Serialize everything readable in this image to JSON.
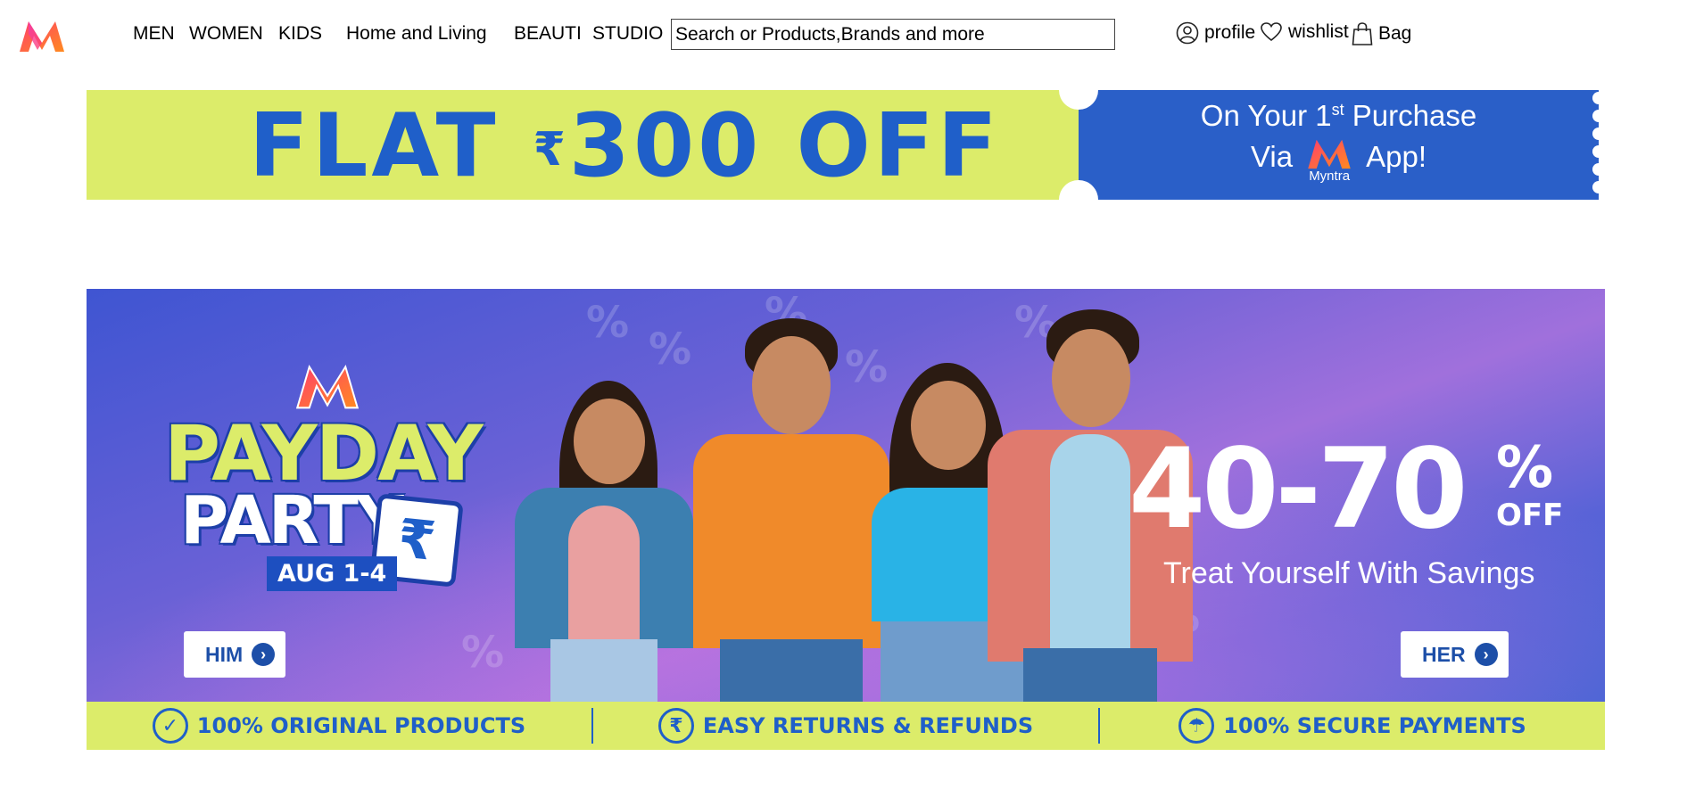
{
  "nav": {
    "items": [
      "MEN",
      "WOMEN",
      "KIDS",
      "Home and Living",
      "BEAUTI",
      "STUDIO"
    ]
  },
  "search": {
    "placeholder": "Search or Products,Brands and more"
  },
  "actions": {
    "profile": "profile",
    "wishlist": "wishlist",
    "bag": "Bag"
  },
  "promo": {
    "headline": "FLAT",
    "currency": "₹",
    "amount": "300 OFF",
    "line1_prefix": "On Your 1",
    "line1_sup": "st",
    "line1_suffix": " Purchase",
    "via": "Via",
    "app": "App!",
    "brand": "Myntra"
  },
  "hero": {
    "payday": "PAYDAY",
    "party": "PARTY",
    "calendar_symbol": "₹",
    "dates": "AUG 1-4",
    "discount": "40-70",
    "percent": "%",
    "off": "OFF",
    "tagline": "Treat Yourself With Savings",
    "him_button": "HIM",
    "her_button": "HER"
  },
  "benefits": [
    {
      "label": "100% ORIGINAL PRODUCTS",
      "icon": "check-circle-icon"
    },
    {
      "label": "EASY RETURNS & REFUNDS",
      "icon": "rupee-return-icon"
    },
    {
      "label": "100% SECURE PAYMENTS",
      "icon": "umbrella-shield-icon"
    }
  ],
  "colors": {
    "brand_blue": "#1f5fc9",
    "lime": "#dcec6a",
    "logo_gradient": [
      "#ff3f6c",
      "#ff8a1f"
    ]
  }
}
